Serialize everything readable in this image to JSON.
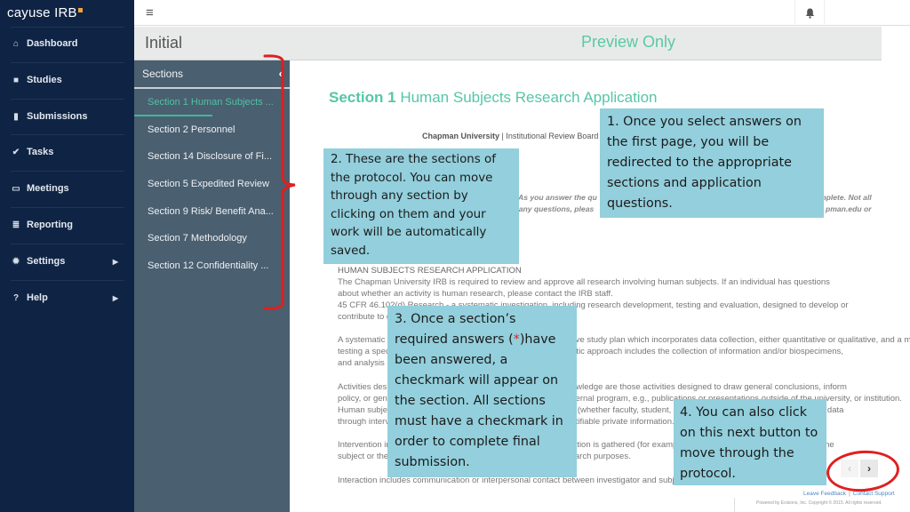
{
  "app": {
    "logo_text": "cayuse IRB",
    "accent_color": "#f5a33a"
  },
  "nav": {
    "items": [
      {
        "label": "Dashboard",
        "icon": "home-icon"
      },
      {
        "label": "Studies",
        "icon": "folder-icon"
      },
      {
        "label": "Submissions",
        "icon": "document-icon"
      },
      {
        "label": "Tasks",
        "icon": "check-icon"
      },
      {
        "label": "Meetings",
        "icon": "calendar-icon"
      },
      {
        "label": "Reporting",
        "icon": "list-icon"
      },
      {
        "label": "Settings",
        "icon": "gear-icon",
        "has_submenu": true
      },
      {
        "label": "Help",
        "icon": "question-icon",
        "has_submenu": true
      }
    ]
  },
  "topbar": {
    "menu_icon": "hamburger-icon",
    "notification_icon": "bell-icon"
  },
  "header": {
    "title": "Initial",
    "mode_label": "Preview Only"
  },
  "sections_panel": {
    "heading": "Sections",
    "items": [
      {
        "label": "Section 1 Human Subjects ...",
        "active": true
      },
      {
        "label": "Section 2 Personnel"
      },
      {
        "label": "Section 14 Disclosure of Fi..."
      },
      {
        "label": "Section 5 Expedited Review"
      },
      {
        "label": "Section 9 Risk/ Benefit Ana..."
      },
      {
        "label": "Section 7 Methodology"
      },
      {
        "label": "Section 12 Confidentiality ..."
      }
    ]
  },
  "content": {
    "section_number": "Section 1",
    "section_title": "Human Subjects Research Application",
    "university": "Chapman University",
    "university_suffix": " | Institutional Review Board",
    "instructions_left_1": "As you answer the qu",
    "instructions_left_2": "r any questions, pleas",
    "instructions_right_1": "mplete. Not all",
    "instructions_right_2": "pman.edu or",
    "paragraphs": [
      "HUMAN SUBJECTS RESEARCH APPLICATION",
      "The Chapman University IRB is required to review and approve all research involving human subjects. If an individual has questions",
      "about whether an activity is human research, please contact the IRB staff.",
      "45 CFR 46.102(d) Research - a systematic investigation, including research development, testing and evaluation, designed to develop or",
      "contribute to generalizable knowledge.",
      "A systematic investigation is an activity that involves a prospective study plan which incorporates data collection, either quantitative or qualitative, and a method or a plan for studying a specific topic, answering a specific question,",
      "testing a specific hypothesis, or developing theory. The systematic approach includes the collection of information and/or biospecimens,",
      "and analysis",
      "Activities designed to develop or contribute to generalizable knowledge are those activities designed to draw general conclusions, inform",
      "policy, or generalize findings beyond a single individual or an internal program, e.g., publications or presentations outside of the university, or institution.",
      "Human subjects - a living individual about whom an investigator (whether faculty, student, or staff) conducting research obtains: (1) data",
      "through intervention or interaction with the individual, or (2) identifiable private information.",
      "Intervention includes both physical procedures by which information is gathered (for example, venipuncture) and manipulations of the",
      "subject or the subject's environment that are performed for research purposes.",
      "Interaction includes communication or interpersonal contact between investigator and subject."
    ]
  },
  "pager": {
    "prev_label": "‹",
    "next_label": "›",
    "prev_disabled": true
  },
  "footer": {
    "feedback_link": "Leave Feedback",
    "support_link": "Contact Support",
    "separator": "|",
    "copyright": "Powered by Evisions, Inc. Copyright © 2015. All rights reserved."
  },
  "callouts": {
    "c1": "1. Once you select answers on the first page, you will be redirected to the appropriate sections and application questions.",
    "c2": "2. These are the sections of the protocol. You can move through any section by clicking on them and your work will be automatically saved.",
    "c3_pre": "3. Once a section’s required answers (",
    "c3_ast": "*",
    "c3_post": ")have been answered, a checkmark will appear on the section. All sections must have a checkmark in order to complete final submission.",
    "c4": "4. You can also click on this next button to move through the protocol."
  },
  "annotation_color": "#e01f1f",
  "callout_color": "#93cfdc"
}
